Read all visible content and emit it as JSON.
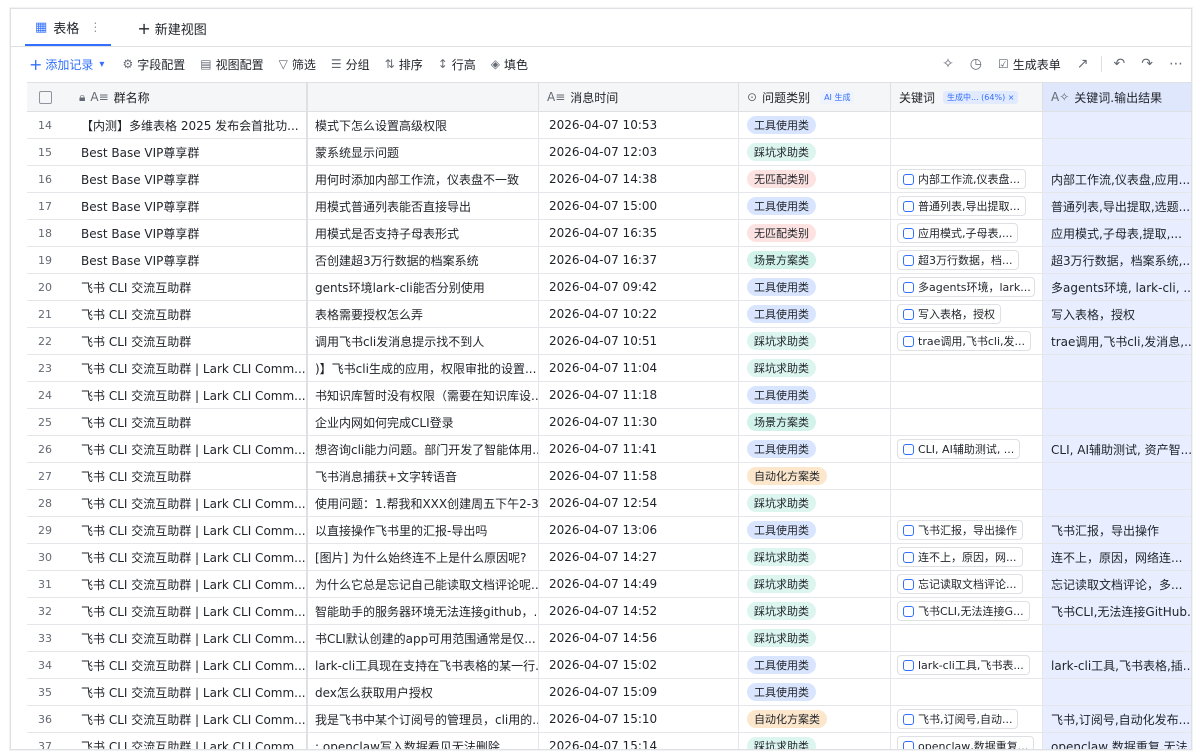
{
  "tabs": {
    "active_label": "表格",
    "new_view_label": "新建视图"
  },
  "toolbar": {
    "add_record": "添加记录",
    "field_config": "字段配置",
    "view_config": "视图配置",
    "filter": "筛选",
    "group": "分组",
    "sort": "排序",
    "row_height": "行高",
    "fill_color": "填色",
    "generate_form": "生成表单"
  },
  "columns": {
    "group_name": "群名称",
    "message_time": "消息时间",
    "category": "问题类别",
    "category_badge": "AI 生成",
    "keywords": "关键词",
    "keywords_badge": "生成中... (64%) ×",
    "keywords_output": "关键词.输出结果"
  },
  "colors": {
    "accent": "#3370ff",
    "tag_tool": "#d9e5ff",
    "tag_pit": "#d1f3ea",
    "tag_nomatch": "#fde2e2",
    "tag_scene": "#d1f3ea",
    "tag_auto": "#fde7cc"
  },
  "rows": [
    {
      "no": "14",
      "group": "【内测】多维表格 2025 发布会首批功...",
      "q": "模式下怎么设置高级权限",
      "time": "2026-04-07 10:53",
      "tag": "工具使用类",
      "tag_color": "#d9e5ff",
      "kw": "",
      "out": ""
    },
    {
      "no": "15",
      "group": "Best Base VIP尊享群",
      "q": "蒙系统显示问题",
      "time": "2026-04-07 12:03",
      "tag": "踩坑求助类",
      "tag_color": "#dcf5ef",
      "kw": "",
      "out": ""
    },
    {
      "no": "16",
      "group": "Best Base VIP尊享群",
      "q": "用何时添加内部工作流，仪表盘不一致",
      "time": "2026-04-07 14:38",
      "tag": "无匹配类别",
      "tag_color": "#fde2e2",
      "kw": "内部工作流,仪表盘...",
      "out": "内部工作流,仪表盘,应用..."
    },
    {
      "no": "17",
      "group": "Best Base VIP尊享群",
      "q": "用模式普通列表能否直接导出",
      "time": "2026-04-07 15:00",
      "tag": "工具使用类",
      "tag_color": "#d9e5ff",
      "kw": "普通列表,导出提取...",
      "out": "普通列表,导出提取,选题..."
    },
    {
      "no": "18",
      "group": "Best Base VIP尊享群",
      "q": "用模式是否支持子母表形式",
      "time": "2026-04-07 16:35",
      "tag": "无匹配类别",
      "tag_color": "#fde2e2",
      "kw": "应用模式,子母表,...",
      "out": "应用模式,子母表,提取,..."
    },
    {
      "no": "19",
      "group": "Best Base VIP尊享群",
      "q": "否创建超3万行数据的档案系统",
      "time": "2026-04-07 16:37",
      "tag": "场景方案类",
      "tag_color": "#d1f3ea",
      "kw": "超3万行数据，档...",
      "out": "超3万行数据，档案系统,..."
    },
    {
      "no": "20",
      "group": "飞书 CLI 交流互助群",
      "q": "gents环境lark-cli能否分别使用",
      "time": "2026-04-07 09:42",
      "tag": "工具使用类",
      "tag_color": "#d9e5ff",
      "kw": "多agents环境，lark...",
      "out": "多agents环境, lark-cli, ..."
    },
    {
      "no": "21",
      "group": "飞书 CLI 交流互助群",
      "q": "表格需要授权怎么弄",
      "time": "2026-04-07 10:22",
      "tag": "工具使用类",
      "tag_color": "#d9e5ff",
      "kw": "写入表格，授权",
      "out": "写入表格，授权"
    },
    {
      "no": "22",
      "group": "飞书 CLI 交流互助群",
      "q": "调用飞书cli发消息提示找不到人",
      "time": "2026-04-07 10:51",
      "tag": "踩坑求助类",
      "tag_color": "#dcf5ef",
      "kw": "trae调用,飞书cli,发...",
      "out": "trae调用,飞书cli,发消息,..."
    },
    {
      "no": "23",
      "group": "飞书 CLI 交流互助群 | Lark CLI Comm...",
      "q": ")】飞书cli生成的应用，权限审批的设置...",
      "time": "2026-04-07 11:04",
      "tag": "踩坑求助类",
      "tag_color": "#dcf5ef",
      "kw": "",
      "out": ""
    },
    {
      "no": "24",
      "group": "飞书 CLI 交流互助群 | Lark CLI Comm...",
      "q": "书知识库暂时没有权限（需要在知识库设...",
      "time": "2026-04-07 11:18",
      "tag": "工具使用类",
      "tag_color": "#d9e5ff",
      "kw": "",
      "out": ""
    },
    {
      "no": "25",
      "group": "飞书 CLI 交流互助群",
      "q": "企业内网如何完成CLI登录",
      "time": "2026-04-07 11:30",
      "tag": "场景方案类",
      "tag_color": "#d1f3ea",
      "kw": "",
      "out": ""
    },
    {
      "no": "26",
      "group": "飞书 CLI 交流互助群 | Lark CLI Comm...",
      "q": "想咨询cli能力问题。部门开发了智能体用...",
      "time": "2026-04-07 11:41",
      "tag": "工具使用类",
      "tag_color": "#d9e5ff",
      "kw": "CLI, AI辅助测试, ...",
      "out": "CLI, AI辅助测试, 资产智..."
    },
    {
      "no": "27",
      "group": "飞书 CLI 交流互助群",
      "q": "飞书消息捕获+文字转语音",
      "time": "2026-04-07 11:58",
      "tag": "自动化方案类",
      "tag_color": "#fde7cc",
      "kw": "",
      "out": ""
    },
    {
      "no": "28",
      "group": "飞书 CLI 交流互助群 | Lark CLI Comm...",
      "q": "使用问题：1.帮我和XXX创建周五下午2-3...",
      "time": "2026-04-07 12:54",
      "tag": "踩坑求助类",
      "tag_color": "#dcf5ef",
      "kw": "",
      "out": ""
    },
    {
      "no": "29",
      "group": "飞书 CLI 交流互助群 | Lark CLI Comm...",
      "q": "以直接操作飞书里的汇报-导出吗",
      "time": "2026-04-07 13:06",
      "tag": "工具使用类",
      "tag_color": "#d9e5ff",
      "kw": "飞书汇报，导出操作",
      "out": "飞书汇报，导出操作"
    },
    {
      "no": "30",
      "group": "飞书 CLI 交流互助群 | Lark CLI Comm...",
      "q": "[图片] 为什么始终连不上是什么原因呢?",
      "time": "2026-04-07 14:27",
      "tag": "踩坑求助类",
      "tag_color": "#dcf5ef",
      "kw": "连不上，原因，网...",
      "out": "连不上，原因，网络连..."
    },
    {
      "no": "31",
      "group": "飞书 CLI 交流互助群 | Lark CLI Comm...",
      "q": "为什么它总是忘记自己能读取文档评论呢...",
      "time": "2026-04-07 14:49",
      "tag": "踩坑求助类",
      "tag_color": "#dcf5ef",
      "kw": "忘记读取文档评论...",
      "out": "忘记读取文档评论，多..."
    },
    {
      "no": "32",
      "group": "飞书 CLI 交流互助群 | Lark CLI Comm...",
      "q": "智能助手的服务器环境无法连接github，...",
      "time": "2026-04-07 14:52",
      "tag": "踩坑求助类",
      "tag_color": "#dcf5ef",
      "kw": "飞书CLI,无法连接G...",
      "out": "飞书CLI,无法连接GitHub..."
    },
    {
      "no": "33",
      "group": "飞书 CLI 交流互助群 | Lark CLI Comm...",
      "q": "书CLI默认创建的app可用范围通常是仅...",
      "time": "2026-04-07 14:56",
      "tag": "踩坑求助类",
      "tag_color": "#dcf5ef",
      "kw": "",
      "out": ""
    },
    {
      "no": "34",
      "group": "飞书 CLI 交流互助群 | Lark CLI Comm...",
      "q": "lark-cli工具现在支持在飞书表格的某一行...",
      "time": "2026-04-07 15:02",
      "tag": "工具使用类",
      "tag_color": "#d9e5ff",
      "kw": "lark-cli工具,飞书表...",
      "out": "lark-cli工具,飞书表格,插..."
    },
    {
      "no": "35",
      "group": "飞书 CLI 交流互助群 | Lark CLI Comm...",
      "q": "dex怎么获取用户授权",
      "time": "2026-04-07 15:09",
      "tag": "工具使用类",
      "tag_color": "#d9e5ff",
      "kw": "",
      "out": ""
    },
    {
      "no": "36",
      "group": "飞书 CLI 交流互助群 | Lark CLI Comm...",
      "q": "我是飞书中某个订阅号的管理员，cli用的...",
      "time": "2026-04-07 15:10",
      "tag": "自动化方案类",
      "tag_color": "#fde7cc",
      "kw": "飞书,订阅号,自动...",
      "out": "飞书,订阅号,自动化发布..."
    },
    {
      "no": "37",
      "group": "飞书 CLI 交流互助群 | Lark CLI Comm...",
      "q": ": openclaw写入数据看见无法删除",
      "time": "2026-04-07 15:14",
      "tag": "踩坑求助类",
      "tag_color": "#dcf5ef",
      "kw": "openclaw,数据重复...",
      "out": "openclaw,数据重复,无法..."
    }
  ]
}
